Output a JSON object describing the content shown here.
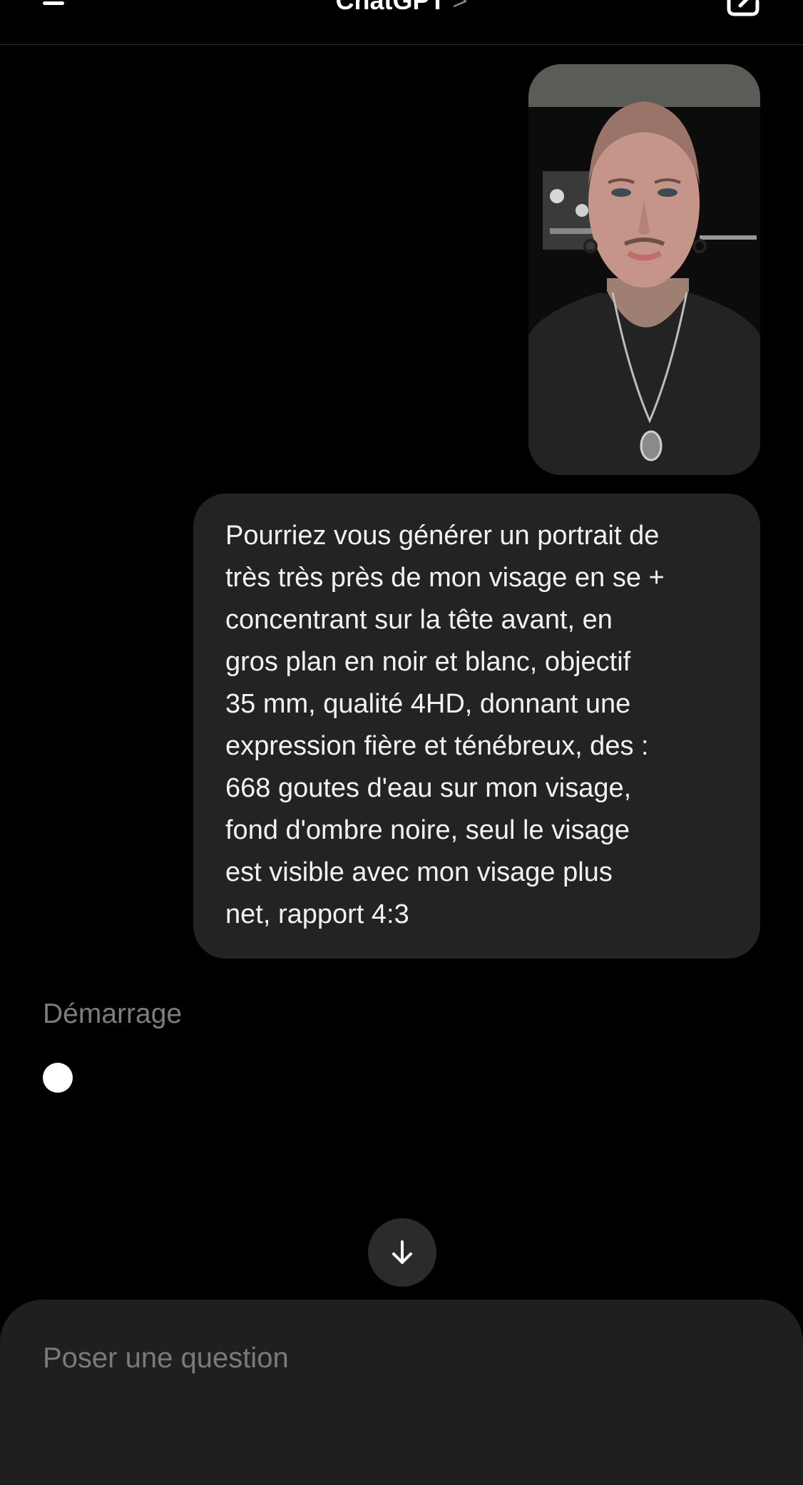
{
  "header": {
    "title": "ChatGPT",
    "title_chevron": ">",
    "menu_icon": "hamburger-menu-icon",
    "new_chat_icon": "new-chat-edit-icon"
  },
  "messages": [
    {
      "role": "user",
      "type": "image",
      "icon": "portrait-photo"
    },
    {
      "role": "user",
      "type": "text",
      "lines": [
        "Pourriez vous générer un portrait de",
        "très très près de mon visage en se +",
        "concentrant sur la tête avant, en",
        "gros plan en noir et blanc, objectif",
        "35 mm, qualité 4HD, donnant une",
        "expression fière et ténébreux, des :",
        "668 goutes d'eau sur mon visage,",
        "fond d'ombre noire, seul le visage",
        "est visible avec mon visage plus",
        "net, rapport 4:3"
      ]
    }
  ],
  "assistant": {
    "status_text": "Démarrage"
  },
  "scroll_button": {
    "icon": "arrow-down-icon"
  },
  "composer": {
    "placeholder": "Poser une question"
  },
  "colors": {
    "background": "#000000",
    "bubble": "#232323",
    "composer": "#1f1f1f",
    "muted_text": "#7d7d7d"
  }
}
